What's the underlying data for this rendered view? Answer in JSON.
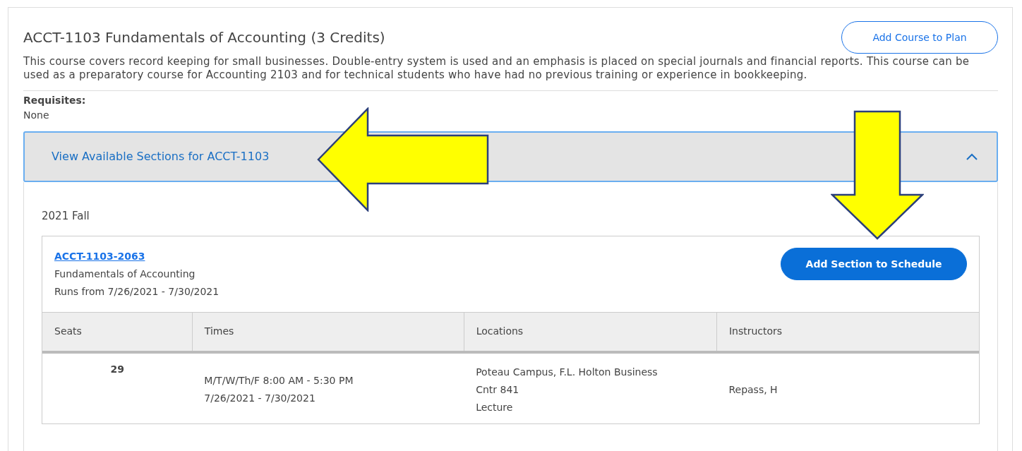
{
  "course": {
    "title": "ACCT-1103 Fundamentals of Accounting (3 Credits)",
    "add_button": "Add Course to Plan",
    "description": "This course covers record keeping for small businesses. Double-entry system is used and an emphasis is placed on special journals and financial reports. This course can be used as a preparatory course for Accounting 2103 and for technical students who have had no previous training or experience in bookkeeping.",
    "requisites_label": "Requisites:",
    "requisites_value": "None"
  },
  "sections_panel": {
    "header": "View Available Sections for ACCT-1103",
    "expanded": true,
    "term": "2021 Fall",
    "section": {
      "code": "ACCT-1103-2063",
      "name": "Fundamentals of Accounting",
      "runs": "Runs from 7/26/2021 - 7/30/2021",
      "add_button": "Add Section to Schedule",
      "table": {
        "columns": [
          "Seats",
          "Times",
          "Locations",
          "Instructors"
        ],
        "rows": [
          {
            "seats": "29",
            "times": [
              "M/T/W/Th/F 8:00 AM - 5:30 PM",
              "7/26/2021 - 7/30/2021"
            ],
            "locations": [
              "Poteau Campus, F.L. Holton Business",
              "Cntr 841",
              "Lecture"
            ],
            "instructors": "Repass, H"
          }
        ]
      }
    }
  },
  "annotations": [
    {
      "kind": "arrow-left"
    },
    {
      "kind": "arrow-down"
    }
  ]
}
